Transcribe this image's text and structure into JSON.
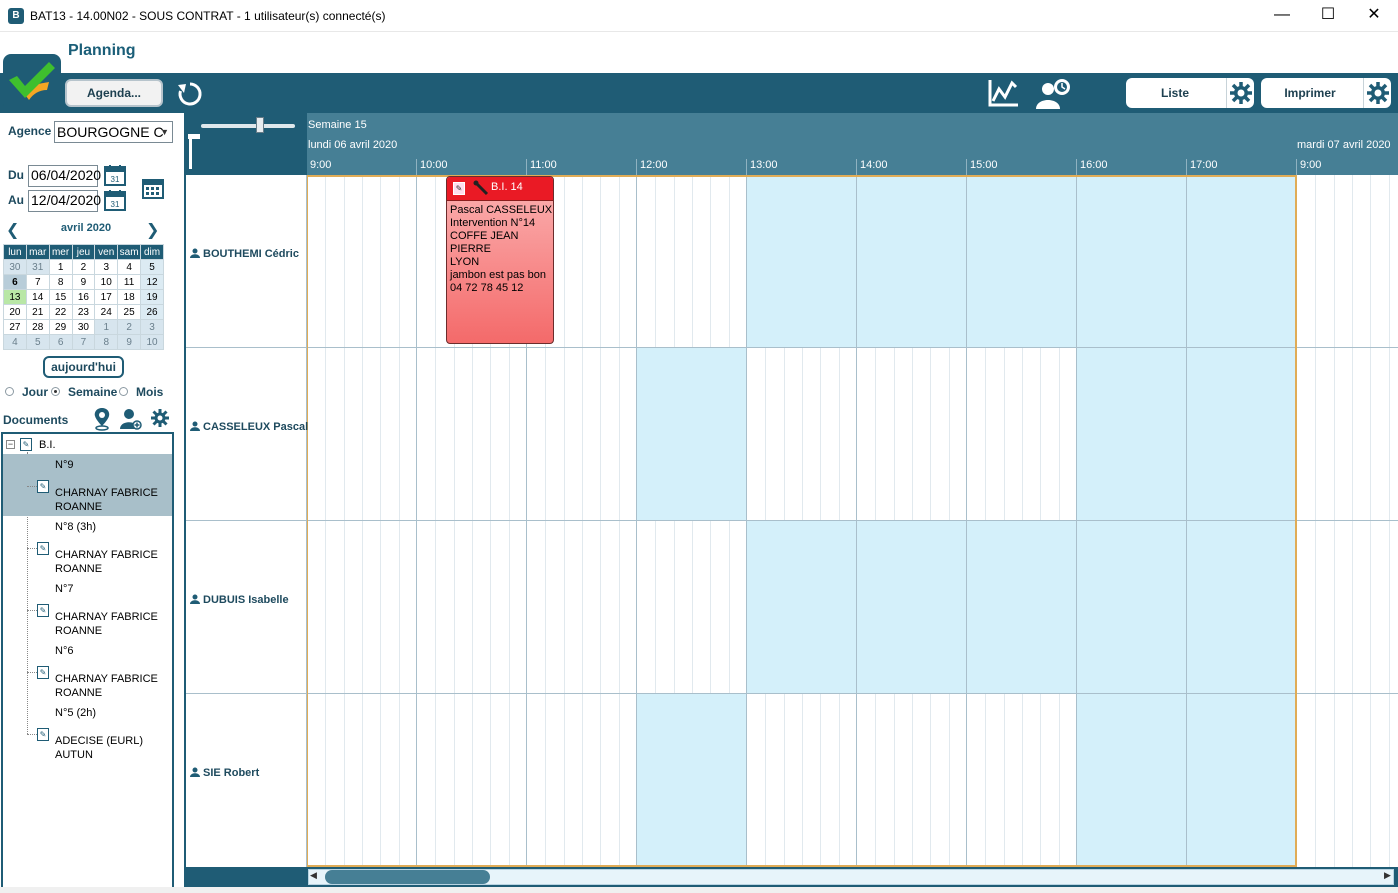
{
  "window": {
    "title": "BAT13 - 14.00N02 - SOUS CONTRAT - 1 utilisateur(s) connecté(s)",
    "app_icon": "B",
    "minimize": "—",
    "maximize": "☐",
    "close": "✕"
  },
  "header": {
    "page_title": "Planning",
    "agenda_label": "Agenda...",
    "liste_label": "Liste",
    "imprimer_label": "Imprimer"
  },
  "filters": {
    "agence_label": "Agence",
    "agence_value": "BOURGOGNE C",
    "du_label": "Du",
    "du_value": "06/04/2020",
    "au_label": "Au",
    "au_value": "12/04/2020",
    "cal_icon_text": "31"
  },
  "calendar": {
    "month_label": "avril 2020",
    "weekdays": [
      "lun",
      "mar",
      "mer",
      "jeu",
      "ven",
      "sam",
      "dim"
    ],
    "weeks": [
      [
        "30",
        "31",
        "1",
        "2",
        "3",
        "4",
        "5"
      ],
      [
        "6",
        "7",
        "8",
        "9",
        "10",
        "11",
        "12"
      ],
      [
        "13",
        "14",
        "15",
        "16",
        "17",
        "18",
        "19"
      ],
      [
        "20",
        "21",
        "22",
        "23",
        "24",
        "25",
        "26"
      ],
      [
        "27",
        "28",
        "29",
        "30",
        "1",
        "2",
        "3"
      ],
      [
        "4",
        "5",
        "6",
        "7",
        "8",
        "9",
        "10"
      ]
    ],
    "today_button": "aujourd'hui"
  },
  "view_modes": {
    "jour": "Jour",
    "semaine": "Semaine",
    "mois": "Mois",
    "selected": "Semaine"
  },
  "documents": {
    "label": "Documents",
    "root": "B.I.",
    "items": [
      {
        "number": "N°9",
        "client": "CHARNAY FABRICE",
        "city": "ROANNE"
      },
      {
        "number": "N°8 (3h)",
        "client": "CHARNAY FABRICE",
        "city": "ROANNE"
      },
      {
        "number": "N°7",
        "client": "CHARNAY FABRICE",
        "city": "ROANNE"
      },
      {
        "number": "N°6",
        "client": "CHARNAY FABRICE",
        "city": "ROANNE"
      },
      {
        "number": "N°5 (2h)",
        "client": "ADECISE (EURL)",
        "city": "AUTUN"
      }
    ]
  },
  "schedule": {
    "week": "Semaine 15",
    "day1": "lundi 06 avril 2020",
    "day2": "mardi 07 avril 2020",
    "hours": [
      "9:00",
      "10:00",
      "11:00",
      "12:00",
      "13:00",
      "14:00",
      "15:00",
      "16:00",
      "17:00",
      "9:00"
    ],
    "resources": [
      "BOUTHEMI Cédric",
      "CASSELEUX Pascal",
      "DUBUIS Isabelle",
      "SIE Robert"
    ],
    "event": {
      "title": "B.I. 14",
      "lines": [
        "Pascal CASSELEUX",
        "Intervention N°14",
        "COFFE JEAN PIERRE",
        "LYON",
        "jambon est pas bon",
        "04 72 78 45 12"
      ]
    }
  },
  "colors": {
    "primary": "#1f5c75",
    "header_band": "#467f95",
    "busy": "#d4f0fa",
    "event": "#ea1a25",
    "workday_frame": "#e0ac56",
    "check_green": "#3fbf2e",
    "check_orange": "#f5a623"
  }
}
